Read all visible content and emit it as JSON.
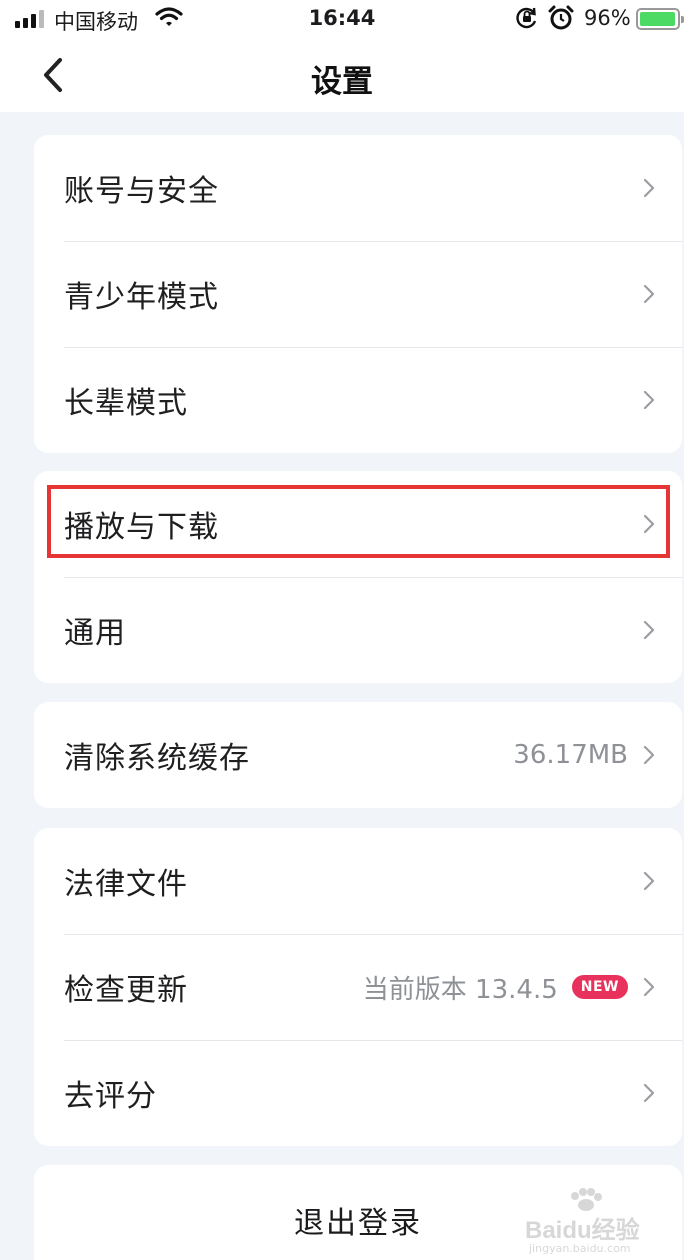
{
  "status_bar": {
    "carrier": "中国移动",
    "time": "16:44",
    "battery_percent": "96%",
    "battery_level": 0.96,
    "icons": [
      "signal-icon",
      "wifi-icon",
      "orientation-lock-icon",
      "alarm-icon",
      "battery-icon"
    ]
  },
  "header": {
    "title": "设置",
    "back_icon": "chevron-left-icon"
  },
  "groups": [
    {
      "items": [
        {
          "label": "账号与安全",
          "value": "",
          "badge": ""
        },
        {
          "label": "青少年模式",
          "value": "",
          "badge": ""
        },
        {
          "label": "长辈模式",
          "value": "",
          "badge": ""
        }
      ]
    },
    {
      "items": [
        {
          "label": "播放与下载",
          "value": "",
          "badge": ""
        },
        {
          "label": "通用",
          "value": "",
          "badge": ""
        }
      ]
    },
    {
      "items": [
        {
          "label": "清除系统缓存",
          "value": "36.17MB",
          "badge": ""
        }
      ]
    },
    {
      "items": [
        {
          "label": "法律文件",
          "value": "",
          "badge": ""
        },
        {
          "label": "检查更新",
          "value": "当前版本 13.4.5",
          "badge": "NEW"
        },
        {
          "label": "去评分",
          "value": "",
          "badge": ""
        }
      ]
    }
  ],
  "logout_label": "退出登录",
  "watermark": {
    "text": "Baidu经验",
    "sub": "jingyan.baidu.com"
  },
  "colors": {
    "background": "#f1f4f8",
    "card": "#ffffff",
    "highlight": "#e53535",
    "badge": "#e8325d",
    "battery": "#4cd964"
  }
}
